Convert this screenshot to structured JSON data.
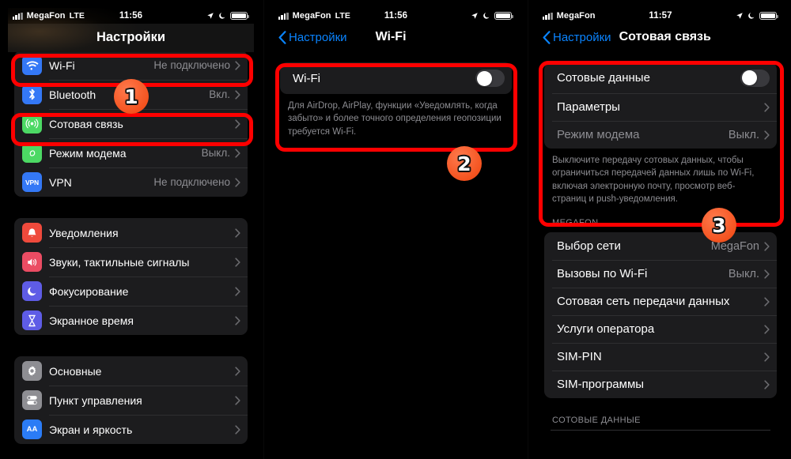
{
  "panels": [
    {
      "id": "settings-main",
      "status": {
        "carrier": "MegaFon",
        "network": "LTE",
        "time": "11:56"
      },
      "nav": {
        "title": "Настройки"
      },
      "groups": [
        {
          "rows": [
            {
              "icon": "wifi-icon",
              "label": "Wi-Fi",
              "value": "Не подключено",
              "chevron": true
            },
            {
              "icon": "bluetooth-icon",
              "label": "Bluetooth",
              "value": "Вкл.",
              "chevron": true
            },
            {
              "icon": "cellular-icon",
              "label": "Сотовая связь",
              "value": "",
              "chevron": true
            },
            {
              "icon": "hotspot-icon",
              "label": "Режим модема",
              "value": "Выкл.",
              "chevron": true
            },
            {
              "icon": "vpn-icon",
              "label": "VPN",
              "value": "Не подключено",
              "chevron": true
            }
          ]
        },
        {
          "rows": [
            {
              "icon": "notifications-icon",
              "label": "Уведомления",
              "value": "",
              "chevron": true
            },
            {
              "icon": "sounds-icon",
              "label": "Звуки, тактильные сигналы",
              "value": "",
              "chevron": true
            },
            {
              "icon": "focus-icon",
              "label": "Фокусирование",
              "value": "",
              "chevron": true
            },
            {
              "icon": "screentime-icon",
              "label": "Экранное время",
              "value": "",
              "chevron": true
            }
          ]
        },
        {
          "rows": [
            {
              "icon": "general-gear-icon",
              "label": "Основные",
              "value": "",
              "chevron": true
            },
            {
              "icon": "control-center-icon",
              "label": "Пункт управления",
              "value": "",
              "chevron": true
            },
            {
              "icon": "display-brightness-icon",
              "label": "Экран и яркость",
              "value": "",
              "chevron": true
            }
          ]
        }
      ]
    },
    {
      "id": "wifi-settings",
      "status": {
        "carrier": "MegaFon",
        "network": "LTE",
        "time": "11:56"
      },
      "nav": {
        "back": "Настройки",
        "title": "Wi-Fi"
      },
      "toggle_row": {
        "label": "Wi-Fi",
        "state": "off"
      },
      "note": "Для AirDrop, AirPlay, функции «Уведомлять, когда забыто» и более точного определения геопозиции требуется Wi-Fi."
    },
    {
      "id": "cellular-settings",
      "status": {
        "carrier": "MegaFon",
        "network": "",
        "time": "11:57"
      },
      "nav": {
        "back": "Настройки",
        "title": "Сотовая связь"
      },
      "rows": [
        {
          "label": "Сотовые данные",
          "type": "toggle",
          "state": "off"
        },
        {
          "label": "Параметры",
          "type": "link",
          "value": "",
          "chevron": true
        },
        {
          "label": "Режим модема",
          "type": "link",
          "value": "Выкл.",
          "chevron": true,
          "dim": true
        }
      ],
      "note": "Выключите передачу сотовых данных, чтобы ограничиться передачей данных лишь по Wi-Fi, включая электронную почту, просмотр веб-страниц и push-уведомления.",
      "section_header": "MEGAFON",
      "carrier_rows": [
        {
          "label": "Выбор сети",
          "value": "MegaFon",
          "chevron": true
        },
        {
          "label": "Вызовы по Wi-Fi",
          "value": "Выкл.",
          "chevron": true
        },
        {
          "label": "Сотовая сеть передачи данных",
          "value": "",
          "chevron": true
        },
        {
          "label": "Услуги оператора",
          "value": "",
          "chevron": true
        },
        {
          "label": "SIM-PIN",
          "value": "",
          "chevron": true
        },
        {
          "label": "SIM-программы",
          "value": "",
          "chevron": true
        }
      ],
      "footer_header": "СОТОВЫЕ ДАННЫЕ"
    }
  ],
  "annotations": {
    "accent_color": "#ff0000",
    "badge_color": "#f4521e",
    "badges": [
      {
        "number": "1"
      },
      {
        "number": "2"
      },
      {
        "number": "3"
      }
    ]
  }
}
